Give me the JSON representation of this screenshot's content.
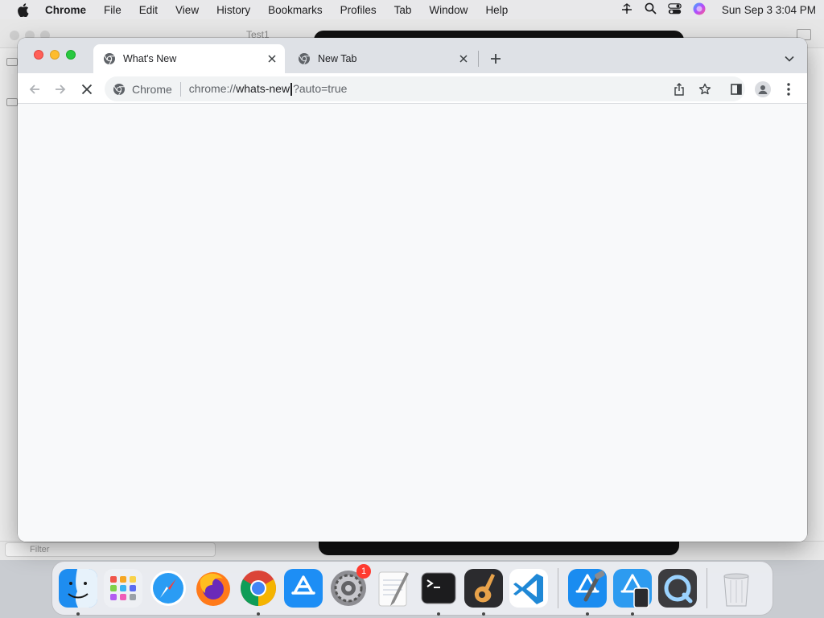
{
  "menubar": {
    "app_name": "Chrome",
    "items": [
      "File",
      "Edit",
      "View",
      "History",
      "Bookmarks",
      "Profiles",
      "Tab",
      "Window",
      "Help"
    ],
    "clock": "Sun Sep 3  3:04 PM"
  },
  "background_window": {
    "scheme_text": "Test1",
    "filter_placeholder": "Filter"
  },
  "browser": {
    "tabs": [
      {
        "label": "What's New",
        "active": true
      },
      {
        "label": "New Tab",
        "active": false
      }
    ],
    "omnibox": {
      "chip": "Chrome",
      "url_prefix": "chrome://",
      "url_host": "whats-new",
      "url_suffix": "?auto=true"
    }
  },
  "dock": {
    "apps": [
      "Finder",
      "Launchpad",
      "Safari",
      "Firefox",
      "Google Chrome",
      "App Store",
      "System Settings",
      "TextEdit",
      "Terminal",
      "GarageBand",
      "Visual Studio Code",
      "Xcode",
      "Simulator",
      "QuickTime Player",
      "Trash"
    ],
    "system_settings_badge": "1"
  },
  "colors": {
    "tabstrip": "#dee1e6",
    "toolbar": "#ffffff",
    "content": "#f8f9fa",
    "close_red": "#ff5f57",
    "minimize_yellow": "#febc2e",
    "zoom_green": "#28c840"
  }
}
